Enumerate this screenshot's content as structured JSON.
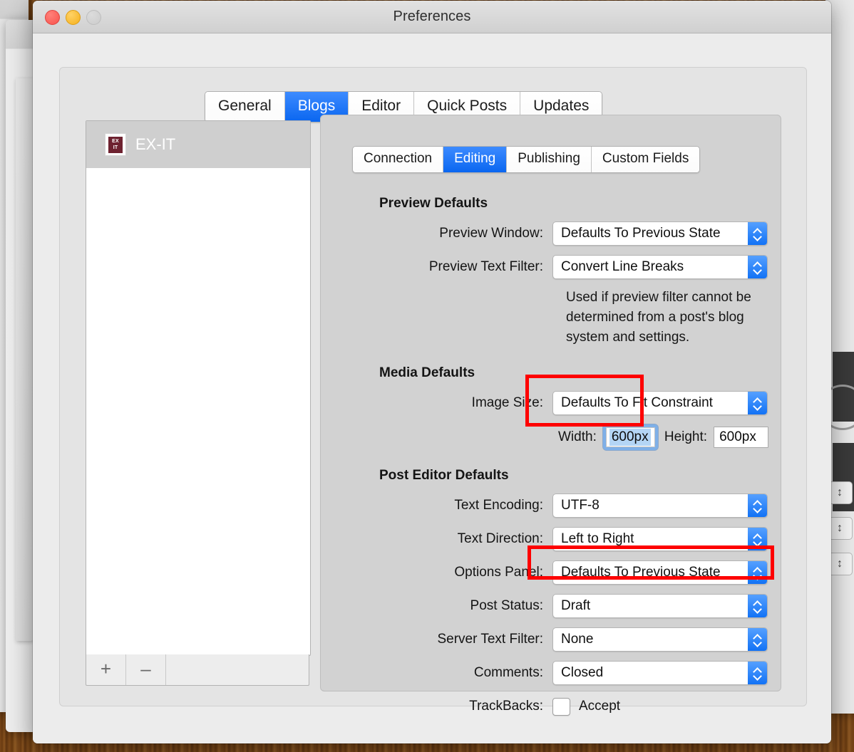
{
  "window": {
    "title": "Preferences",
    "traffic_lights": [
      "close",
      "minimize",
      "zoom"
    ]
  },
  "outer_tabs": [
    {
      "label": "General",
      "selected": false
    },
    {
      "label": "Blogs",
      "selected": true
    },
    {
      "label": "Editor",
      "selected": false
    },
    {
      "label": "Quick Posts",
      "selected": false
    },
    {
      "label": "Updates",
      "selected": false
    }
  ],
  "inner_tabs": [
    {
      "label": "Connection",
      "selected": false
    },
    {
      "label": "Editing",
      "selected": true
    },
    {
      "label": "Publishing",
      "selected": false
    },
    {
      "label": "Custom Fields",
      "selected": false
    }
  ],
  "blog_list": {
    "items": [
      {
        "name": "EX-IT",
        "favicon_line1": "EX",
        "favicon_line2": "IT",
        "selected": true
      }
    ],
    "add_label": "+",
    "remove_label": "–"
  },
  "sections": {
    "preview": {
      "header": "Preview Defaults",
      "rows": [
        {
          "label": "Preview Window:",
          "value": "Defaults To Previous State"
        },
        {
          "label": "Preview Text Filter:",
          "value": "Convert Line Breaks"
        }
      ],
      "note": "Used if preview filter cannot be determined from a post's blog system and settings."
    },
    "media": {
      "header": "Media Defaults",
      "image_size": {
        "label": "Image Size:",
        "value": "Defaults To Fit Constraint"
      },
      "width": {
        "label": "Width:",
        "value": "600px"
      },
      "height": {
        "label": "Height:",
        "value": "600px"
      }
    },
    "post_editor": {
      "header": "Post Editor Defaults",
      "rows": [
        {
          "label": "Text Encoding:",
          "value": "UTF-8"
        },
        {
          "label": "Text Direction:",
          "value": "Left to Right"
        },
        {
          "label": "Options Panel:",
          "value": "Defaults To Previous State"
        },
        {
          "label": "Post Status:",
          "value": "Draft"
        },
        {
          "label": "Server Text Filter:",
          "value": "None"
        },
        {
          "label": "Comments:",
          "value": "Closed"
        }
      ],
      "trackbacks": {
        "label": "TrackBacks:",
        "checkbox_label": "Accept",
        "checked": false
      }
    }
  },
  "annotations": {
    "highlight_color": "#fe0000",
    "boxes": [
      "image-size-width-height",
      "post-status"
    ]
  },
  "colors": {
    "accent_blue": "#0a66f0",
    "stepper_blue": "#1272f5",
    "focus_ring": "#7fb0e8",
    "selection": "#b4d5f5",
    "favicon": "#6e2230"
  }
}
